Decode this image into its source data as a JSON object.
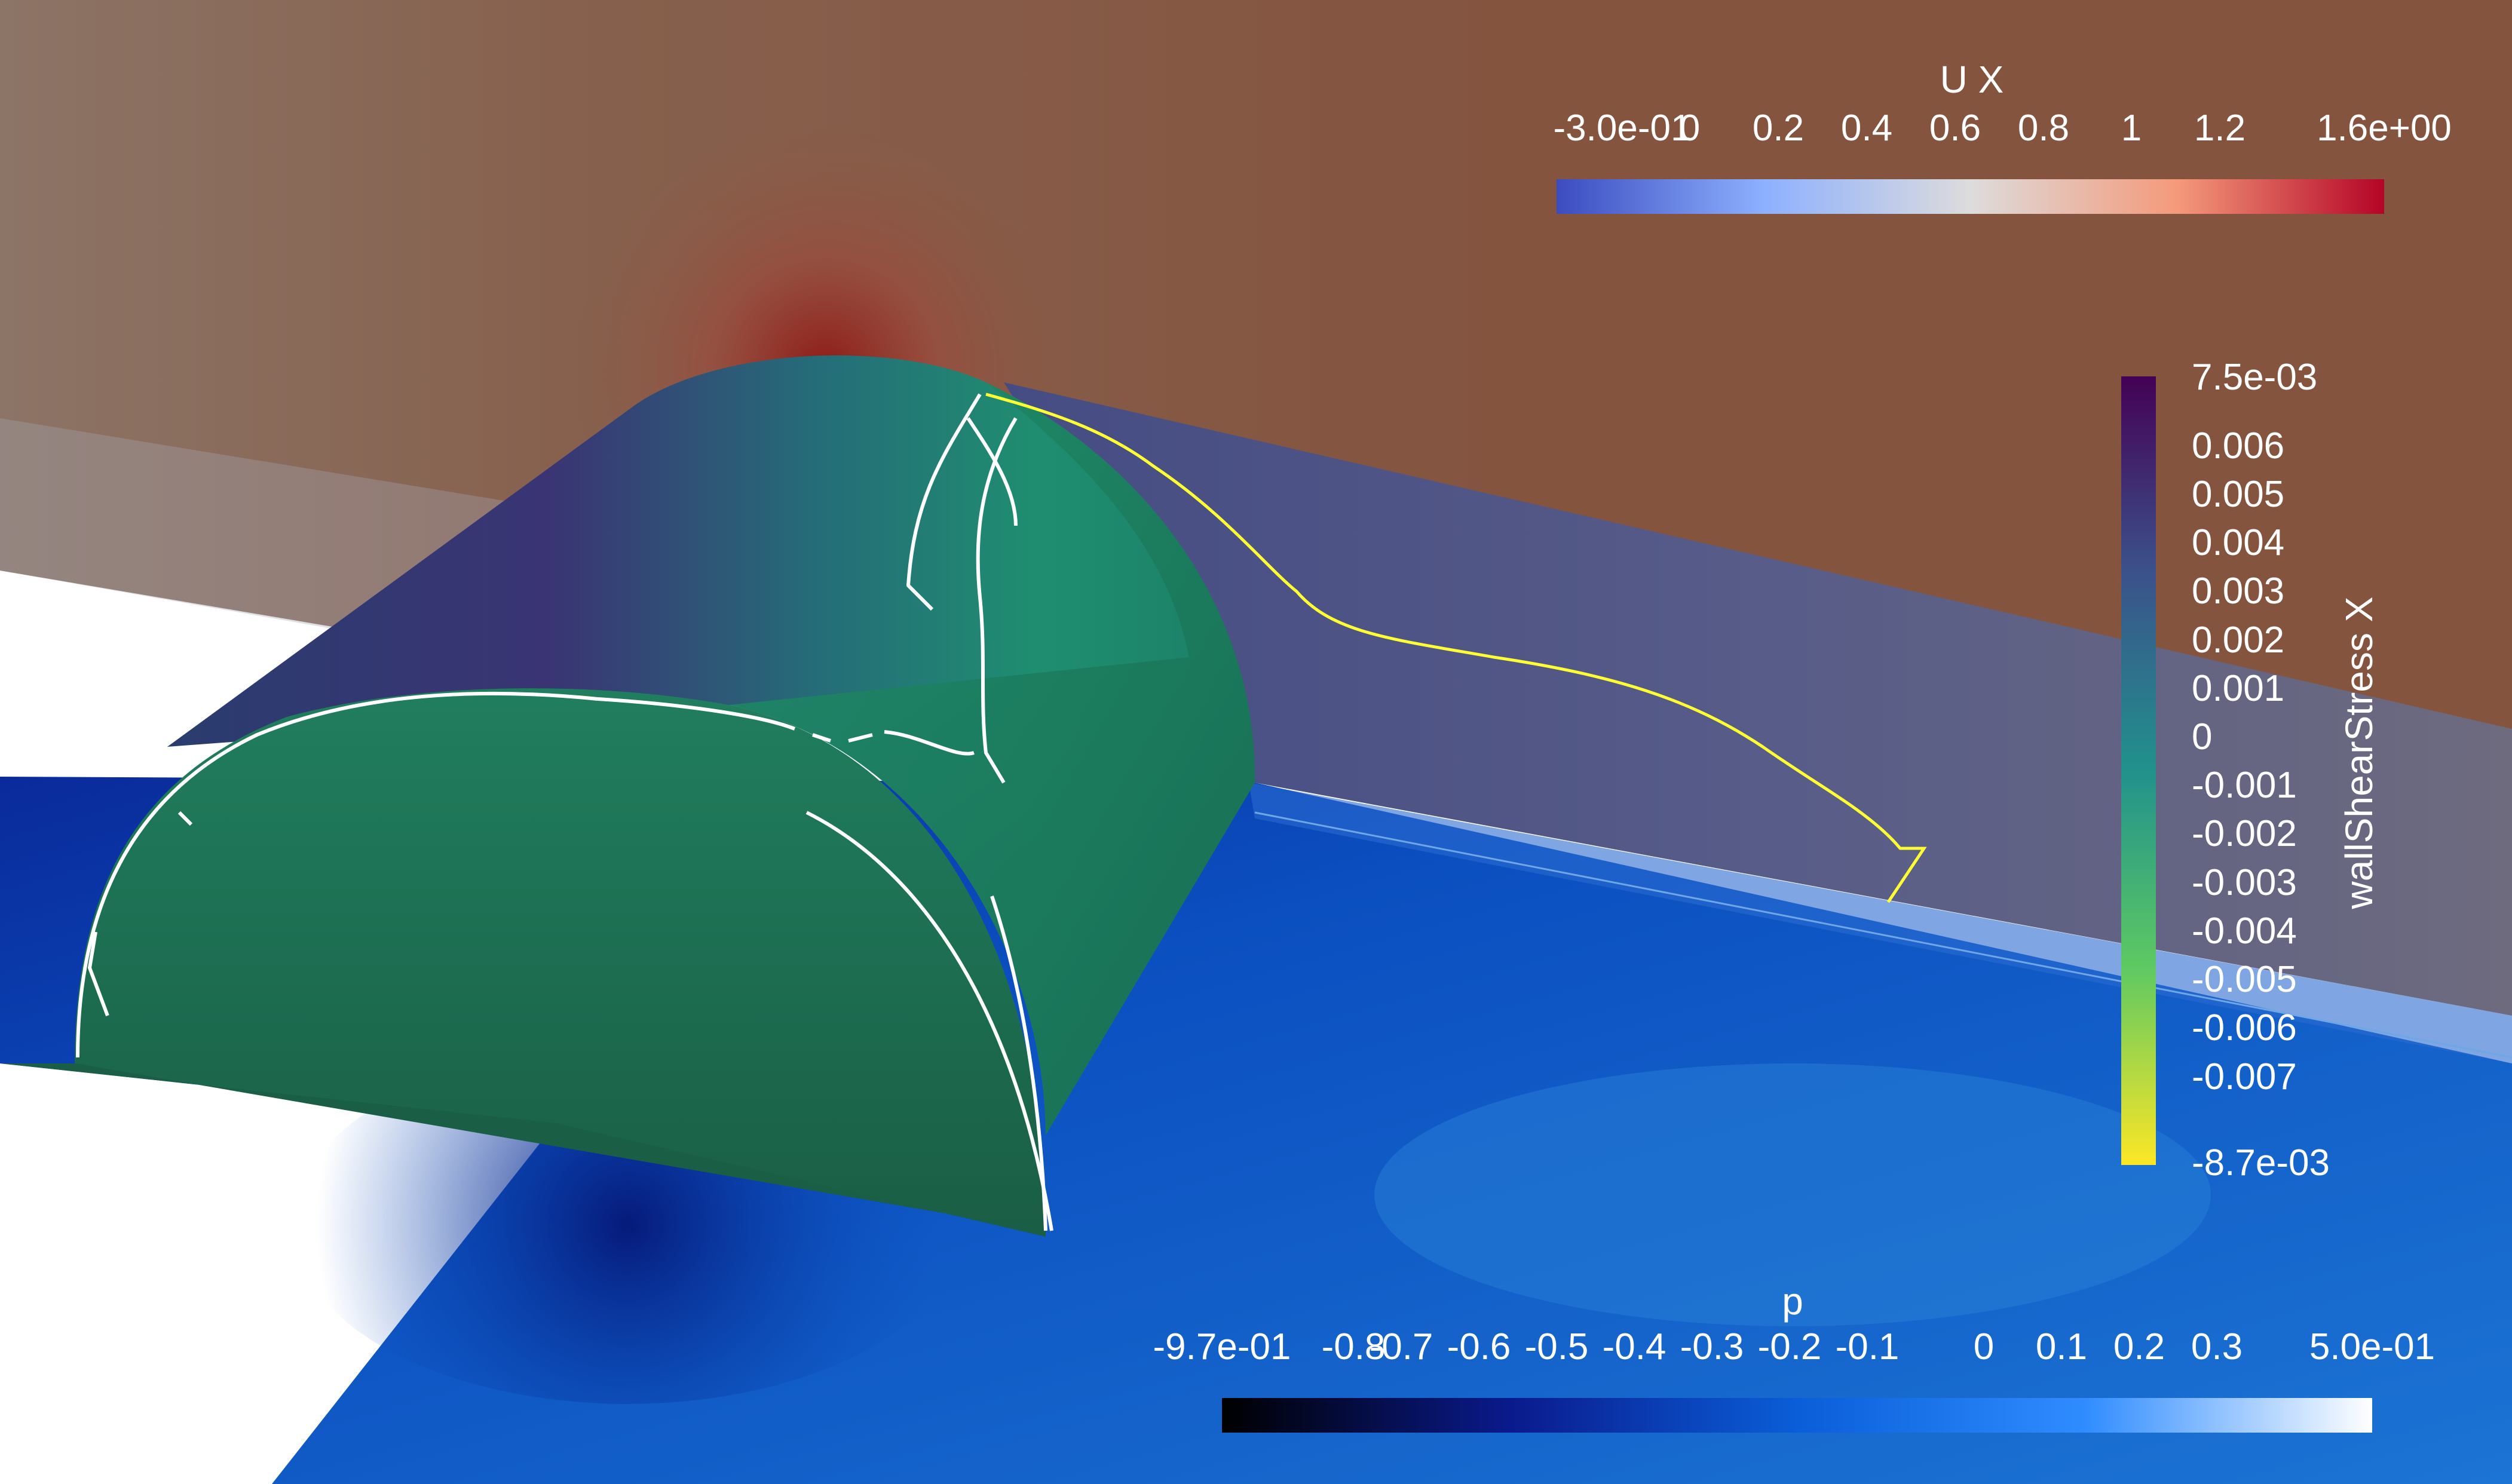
{
  "colorbars": {
    "ux": {
      "title": "U X",
      "ticks": [
        "-3.0e-01",
        "0",
        "0.2",
        "0.4",
        "0.6",
        "0.8",
        "1",
        "1.2",
        "1.6e+00"
      ],
      "colors": [
        "#3b4cc0",
        "#8db0fe",
        "#dddcdc",
        "#f49a7b",
        "#b40426"
      ]
    },
    "wallShearStress": {
      "title": "wallShearStress X",
      "ticks": [
        "7.5e-03",
        "0.006",
        "0.005",
        "0.004",
        "0.003",
        "0.002",
        "0.001",
        "0",
        "-0.001",
        "-0.002",
        "-0.003",
        "-0.004",
        "-0.005",
        "-0.006",
        "-0.007",
        "-8.7e-03"
      ],
      "colors": [
        "#fde725",
        "#5ec962",
        "#21918c",
        "#3b528b",
        "#440154"
      ]
    },
    "p": {
      "title": "p",
      "ticks": [
        "-9.7e-01",
        "-0.8",
        "-0.7",
        "-0.6",
        "-0.5",
        "-0.4",
        "-0.3",
        "-0.2",
        "-0.1",
        "0",
        "0.1",
        "0.2",
        "0.3",
        "5.0e-01"
      ],
      "colors": [
        "#000000",
        "#0a1a8c",
        "#0a5ed8",
        "#2f8cff",
        "#ffffff"
      ]
    }
  },
  "scene": {
    "background_color": "#ffffff",
    "upper_plane_color": "#8a5a44",
    "lower_plane_color": "#1060c8",
    "cylinder_color": "#1f8f6a",
    "streamline_color": "#ffff33",
    "contour_color": "#ffffff"
  }
}
